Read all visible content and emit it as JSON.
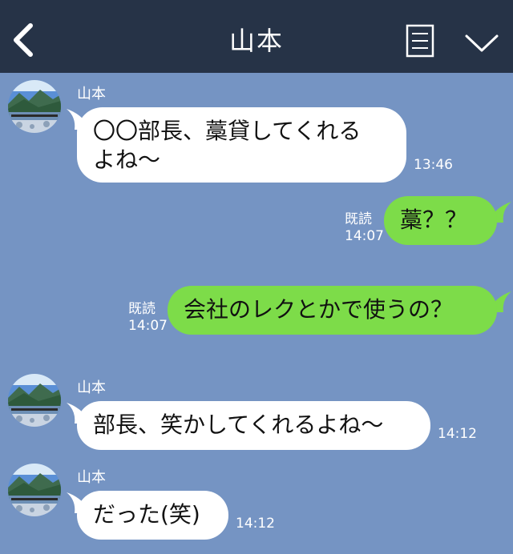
{
  "header": {
    "title": "山本",
    "back_icon": "chevron-left-icon",
    "menu_icon": "note-list-icon",
    "expand_icon": "chevron-down-icon",
    "background": "#263347"
  },
  "chat": {
    "background": "#7594c3",
    "outgoing_bubble_color": "#7ddc49",
    "incoming_bubble_color": "#ffffff",
    "messages": [
      {
        "sender": "山本",
        "text": "〇〇部長、藁貸してくれる\nよね～",
        "time": "13:46"
      },
      {
        "text": "藁？？",
        "read": "既読",
        "time": "14:07"
      },
      {
        "text": "会社のレクとかで使うの？",
        "read": "既読",
        "time": "14:07"
      },
      {
        "sender": "山本",
        "text": "部長、笑かしてくれるよね～",
        "time": "14:12"
      },
      {
        "sender": "山本",
        "text": "だった(笑)",
        "time": "14:12"
      }
    ]
  }
}
